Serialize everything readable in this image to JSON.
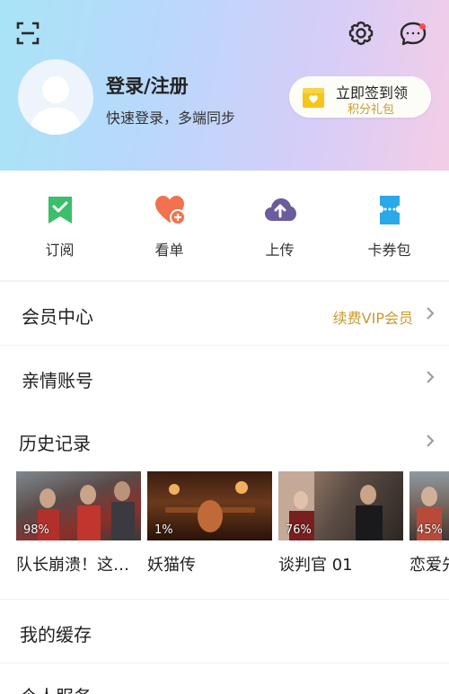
{
  "header": {
    "login_title": "登录/注册",
    "login_subtitle": "快速登录，多端同步",
    "signin_line1": "立即签到领",
    "signin_line2": "积分礼包",
    "accent_gold": "#c89b2a"
  },
  "quick_actions": [
    {
      "label": "订阅",
      "icon": "bookmark-check-icon",
      "color": "#3bbf6a"
    },
    {
      "label": "看单",
      "icon": "heart-plus-icon",
      "color": "#f2724f"
    },
    {
      "label": "上传",
      "icon": "cloud-upload-icon",
      "color": "#6a5c9e"
    },
    {
      "label": "卡券包",
      "icon": "ticket-icon",
      "color": "#2aa8e8"
    }
  ],
  "rows": {
    "vip": {
      "title": "会员中心",
      "hint": "续费VIP会员"
    },
    "family": {
      "title": "亲情账号"
    }
  },
  "history": {
    "title": "历史记录",
    "items": [
      {
        "percent": "98%",
        "name": "队长崩溃！这…"
      },
      {
        "percent": "1%",
        "name": "妖猫传"
      },
      {
        "percent": "76%",
        "name": "谈判官 01"
      },
      {
        "percent": "45%",
        "name": "恋爱先"
      }
    ]
  },
  "cache": {
    "title": "我的缓存"
  },
  "personal": {
    "title": "个人服务"
  }
}
